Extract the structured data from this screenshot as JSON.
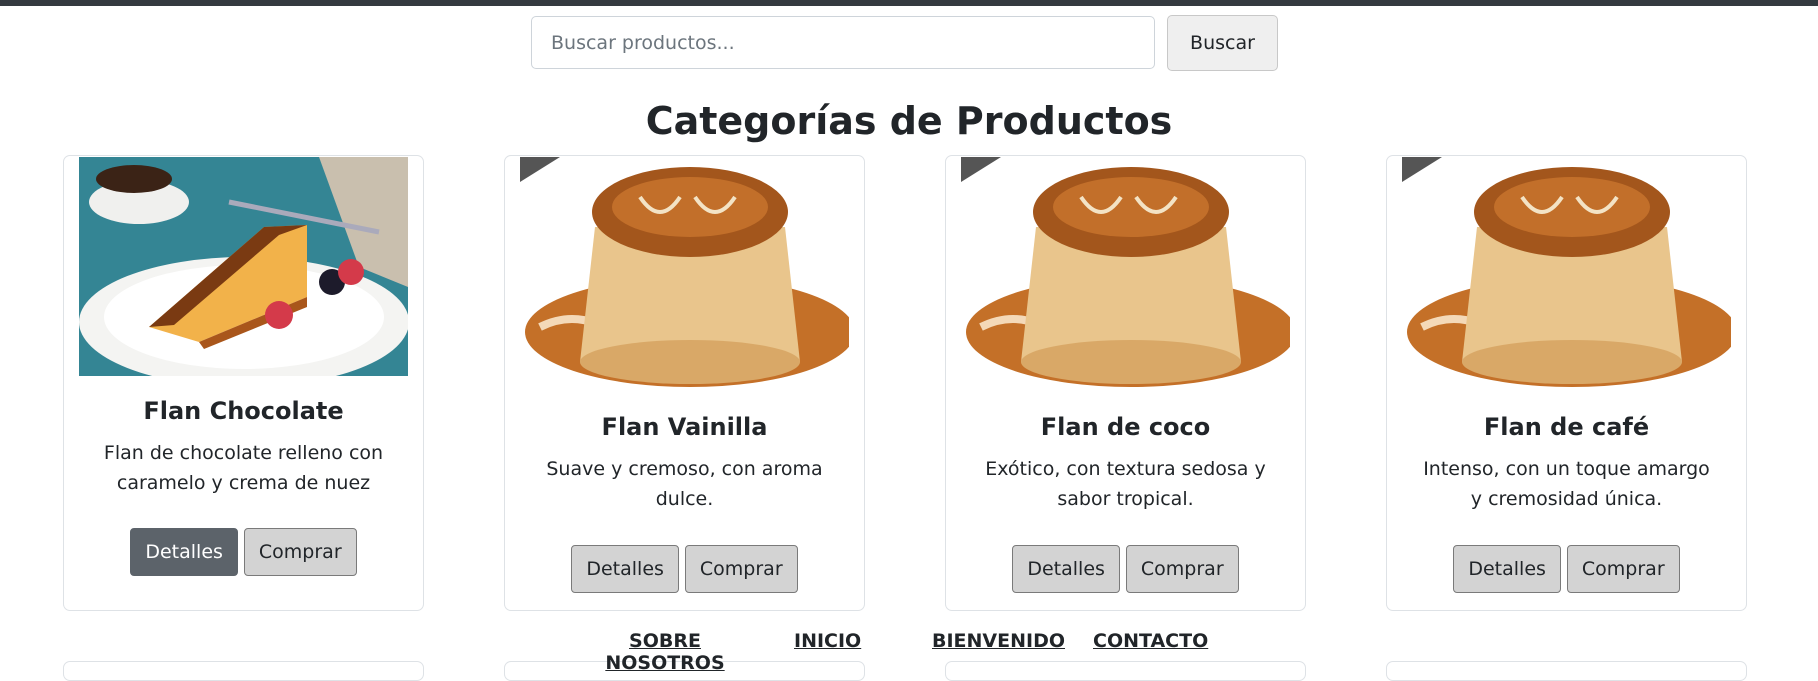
{
  "search": {
    "placeholder": "Buscar productos...",
    "button_label": "Buscar"
  },
  "page_title": "Categorías de Productos",
  "products": [
    {
      "title": "Flan Chocolate",
      "description": "Flan de chocolate relleno con caramelo y crema de nuez",
      "details_label": "Detalles",
      "buy_label": "Comprar"
    },
    {
      "title": "Flan Vainilla",
      "description": "Suave y cremoso, con aroma dulce.",
      "details_label": "Detalles",
      "buy_label": "Comprar"
    },
    {
      "title": "Flan de coco",
      "description": "Exótico, con textura sedosa y sabor tropical.",
      "details_label": "Detalles",
      "buy_label": "Comprar"
    },
    {
      "title": "Flan de café",
      "description": "Intenso, con un toque amargo y cremosidad única.",
      "details_label": "Detalles",
      "buy_label": "Comprar"
    }
  ],
  "nav": {
    "about": "SOBRE NOSOTROS",
    "home": "INICIO",
    "welcome": "BIENVENIDO",
    "contact": "CONTACTO"
  },
  "colors": {
    "topbar": "#343a40",
    "button_active": "#5c636a",
    "button": "#d3d3d3",
    "caramel": "#b8651f"
  }
}
